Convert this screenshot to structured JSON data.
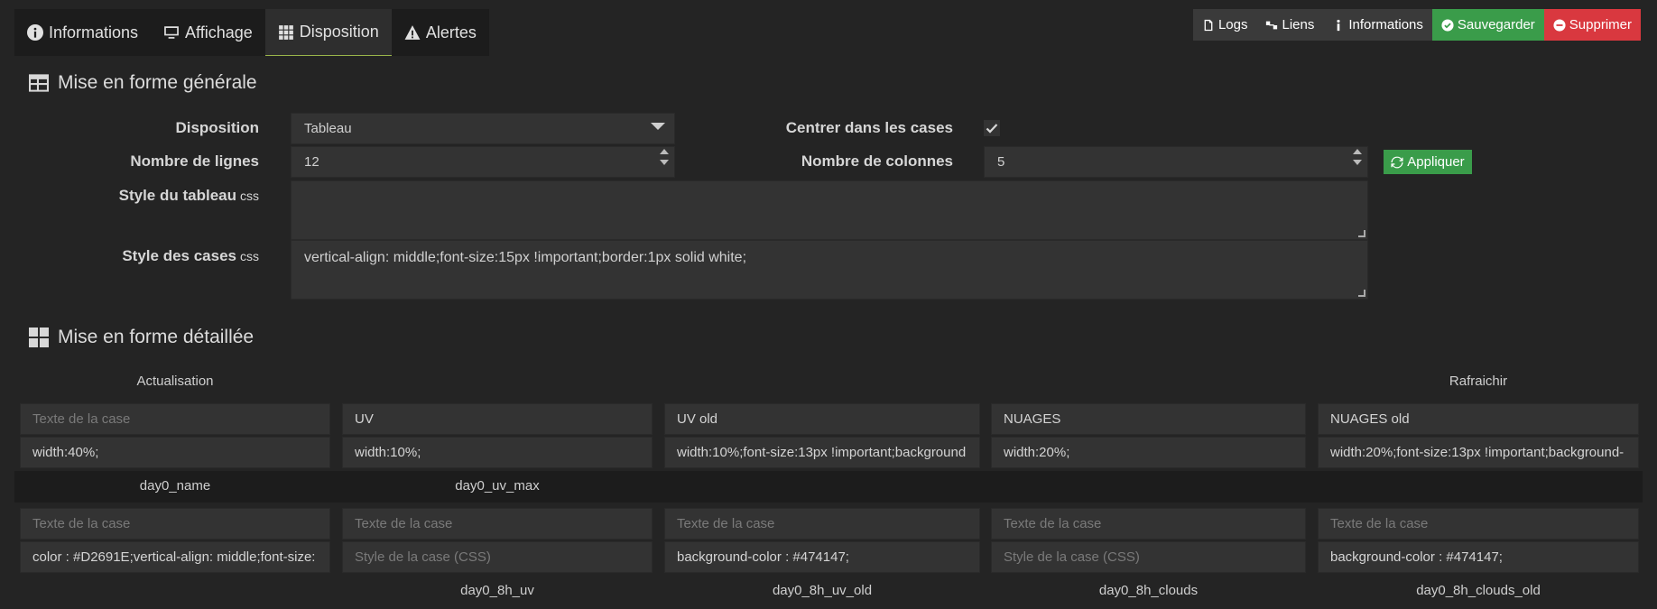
{
  "tabs": [
    {
      "label": "Informations",
      "icon": "info-circle-icon"
    },
    {
      "label": "Affichage",
      "icon": "monitor-icon"
    },
    {
      "label": "Disposition",
      "icon": "grid-icon"
    },
    {
      "label": "Alertes",
      "icon": "warning-icon"
    }
  ],
  "actions": {
    "logs": "Logs",
    "liens": "Liens",
    "informations": "Informations",
    "save": "Sauvegarder",
    "delete": "Supprimer"
  },
  "general": {
    "title": "Mise en forme générale",
    "disposition_label": "Disposition",
    "disposition_value": "Tableau",
    "center_label": "Centrer dans les cases",
    "center_checked": true,
    "rows_label": "Nombre de lignes",
    "rows_value": "12",
    "cols_label": "Nombre de colonnes",
    "cols_value": "5",
    "apply_label": "Appliquer",
    "table_style_label": "Style du tableau",
    "table_style_suffix": "css",
    "table_style_value": "",
    "cell_style_label": "Style des cases",
    "cell_style_suffix": "css",
    "cell_style_value": "vertical-align: middle;font-size:15px !important;border:1px solid white;"
  },
  "detailed": {
    "title": "Mise en forme détaillée",
    "placeholder_text": "Texte de la case",
    "placeholder_style": "Style de la case (CSS)",
    "row1_headers": [
      "Actualisation",
      "",
      "",
      "",
      "Rafraichir"
    ],
    "row1_texts": [
      "",
      "UV",
      "UV old",
      "NUAGES",
      "NUAGES old"
    ],
    "row1_styles": [
      "width:40%;",
      "width:10%;",
      "width:10%;font-size:13px !important;background",
      "width:20%;",
      "width:20%;font-size:13px !important;background-"
    ],
    "row2_headers": [
      "day0_name",
      "day0_uv_max",
      "",
      "",
      ""
    ],
    "row2_texts": [
      "",
      "",
      "",
      "",
      ""
    ],
    "row2_styles": [
      "color :  #D2691E;vertical-align: middle;font-size:",
      "",
      "background-color : #474147;",
      "",
      "background-color : #474147;"
    ],
    "row3_headers": [
      "",
      "day0_8h_uv",
      "day0_8h_uv_old",
      "day0_8h_clouds",
      "day0_8h_clouds_old"
    ]
  },
  "colors": {
    "accent_green": "#3a9c4a",
    "danger_red": "#d9383f",
    "tab_underline": "#9ab54a"
  }
}
